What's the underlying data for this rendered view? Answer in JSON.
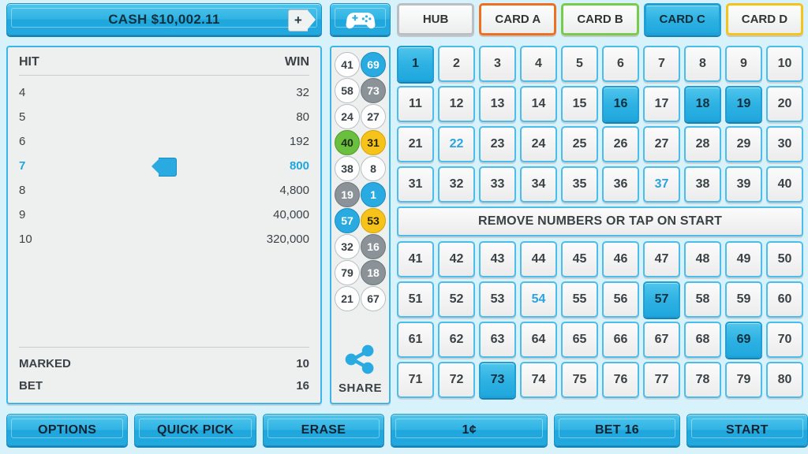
{
  "topbar": {
    "cash_label": "CASH $10,002.11",
    "add_credit_icon": "plus-icon",
    "add_credit_label": "+",
    "game_icon": "gamepad-icon",
    "tabs": [
      {
        "label": "HUB",
        "accent": "#b9bfc2",
        "selected": false
      },
      {
        "label": "CARD A",
        "accent": "#ee6f1f",
        "selected": false
      },
      {
        "label": "CARD B",
        "accent": "#79cc4a",
        "selected": false
      },
      {
        "label": "CARD C",
        "accent": "#1f9fd4",
        "selected": true
      },
      {
        "label": "CARD D",
        "accent": "#f6c31b",
        "selected": false
      }
    ]
  },
  "paytable": {
    "header": {
      "hit": "HIT",
      "win": "WIN"
    },
    "rows": [
      {
        "hit": "4",
        "win": "32",
        "highlighted": false
      },
      {
        "hit": "5",
        "win": "80",
        "highlighted": false
      },
      {
        "hit": "6",
        "win": "192",
        "highlighted": false
      },
      {
        "hit": "7",
        "win": "800",
        "highlighted": true
      },
      {
        "hit": "8",
        "win": "4,800",
        "highlighted": false
      },
      {
        "hit": "9",
        "win": "40,000",
        "highlighted": false
      },
      {
        "hit": "10",
        "win": "320,000",
        "highlighted": false
      }
    ],
    "footer": [
      {
        "label": "MARKED",
        "value": "10"
      },
      {
        "label": "BET",
        "value": "16"
      }
    ]
  },
  "draw_column": {
    "balls": [
      {
        "n": "41",
        "color": "white"
      },
      {
        "n": "69",
        "color": "blue"
      },
      {
        "n": "58",
        "color": "white"
      },
      {
        "n": "73",
        "color": "gray"
      },
      {
        "n": "24",
        "color": "white"
      },
      {
        "n": "27",
        "color": "white"
      },
      {
        "n": "40",
        "color": "green"
      },
      {
        "n": "31",
        "color": "gold"
      },
      {
        "n": "38",
        "color": "white"
      },
      {
        "n": "8",
        "color": "white"
      },
      {
        "n": "19",
        "color": "gray"
      },
      {
        "n": "1",
        "color": "blue"
      },
      {
        "n": "57",
        "color": "blue"
      },
      {
        "n": "53",
        "color": "gold"
      },
      {
        "n": "32",
        "color": "white"
      },
      {
        "n": "16",
        "color": "gray"
      },
      {
        "n": "79",
        "color": "white"
      },
      {
        "n": "18",
        "color": "gray"
      },
      {
        "n": "21",
        "color": "white"
      },
      {
        "n": "67",
        "color": "white"
      }
    ],
    "share_icon": "share-icon",
    "share_label": "SHARE"
  },
  "board": {
    "banner_message": "REMOVE NUMBERS OR TAP ON START",
    "rows_top": [
      [
        {
          "n": "1",
          "state": "selected"
        },
        {
          "n": "2",
          "state": "normal"
        },
        {
          "n": "3",
          "state": "normal"
        },
        {
          "n": "4",
          "state": "normal"
        },
        {
          "n": "5",
          "state": "normal"
        },
        {
          "n": "6",
          "state": "normal"
        },
        {
          "n": "7",
          "state": "normal"
        },
        {
          "n": "8",
          "state": "normal"
        },
        {
          "n": "9",
          "state": "normal"
        },
        {
          "n": "10",
          "state": "normal"
        }
      ],
      [
        {
          "n": "11",
          "state": "normal"
        },
        {
          "n": "12",
          "state": "normal"
        },
        {
          "n": "13",
          "state": "normal"
        },
        {
          "n": "14",
          "state": "normal"
        },
        {
          "n": "15",
          "state": "normal"
        },
        {
          "n": "16",
          "state": "selected"
        },
        {
          "n": "17",
          "state": "normal"
        },
        {
          "n": "18",
          "state": "selected"
        },
        {
          "n": "19",
          "state": "selected"
        },
        {
          "n": "20",
          "state": "normal"
        }
      ],
      [
        {
          "n": "21",
          "state": "normal"
        },
        {
          "n": "22",
          "state": "hint"
        },
        {
          "n": "23",
          "state": "normal"
        },
        {
          "n": "24",
          "state": "normal"
        },
        {
          "n": "25",
          "state": "normal"
        },
        {
          "n": "26",
          "state": "normal"
        },
        {
          "n": "27",
          "state": "normal"
        },
        {
          "n": "28",
          "state": "normal"
        },
        {
          "n": "29",
          "state": "normal"
        },
        {
          "n": "30",
          "state": "normal"
        }
      ],
      [
        {
          "n": "31",
          "state": "normal"
        },
        {
          "n": "32",
          "state": "normal"
        },
        {
          "n": "33",
          "state": "normal"
        },
        {
          "n": "34",
          "state": "normal"
        },
        {
          "n": "35",
          "state": "normal"
        },
        {
          "n": "36",
          "state": "normal"
        },
        {
          "n": "37",
          "state": "hint"
        },
        {
          "n": "38",
          "state": "normal"
        },
        {
          "n": "39",
          "state": "normal"
        },
        {
          "n": "40",
          "state": "normal"
        }
      ]
    ],
    "rows_bottom": [
      [
        {
          "n": "41",
          "state": "normal"
        },
        {
          "n": "42",
          "state": "normal"
        },
        {
          "n": "43",
          "state": "normal"
        },
        {
          "n": "44",
          "state": "normal"
        },
        {
          "n": "45",
          "state": "normal"
        },
        {
          "n": "46",
          "state": "normal"
        },
        {
          "n": "47",
          "state": "normal"
        },
        {
          "n": "48",
          "state": "normal"
        },
        {
          "n": "49",
          "state": "normal"
        },
        {
          "n": "50",
          "state": "normal"
        }
      ],
      [
        {
          "n": "51",
          "state": "normal"
        },
        {
          "n": "52",
          "state": "normal"
        },
        {
          "n": "53",
          "state": "normal"
        },
        {
          "n": "54",
          "state": "hint"
        },
        {
          "n": "55",
          "state": "normal"
        },
        {
          "n": "56",
          "state": "normal"
        },
        {
          "n": "57",
          "state": "selected"
        },
        {
          "n": "58",
          "state": "normal"
        },
        {
          "n": "59",
          "state": "normal"
        },
        {
          "n": "60",
          "state": "normal"
        }
      ],
      [
        {
          "n": "61",
          "state": "normal"
        },
        {
          "n": "62",
          "state": "normal"
        },
        {
          "n": "63",
          "state": "normal"
        },
        {
          "n": "64",
          "state": "normal"
        },
        {
          "n": "65",
          "state": "normal"
        },
        {
          "n": "66",
          "state": "normal"
        },
        {
          "n": "67",
          "state": "normal"
        },
        {
          "n": "68",
          "state": "normal"
        },
        {
          "n": "69",
          "state": "selected"
        },
        {
          "n": "70",
          "state": "normal"
        }
      ],
      [
        {
          "n": "71",
          "state": "normal"
        },
        {
          "n": "72",
          "state": "normal"
        },
        {
          "n": "73",
          "state": "selected"
        },
        {
          "n": "74",
          "state": "normal"
        },
        {
          "n": "75",
          "state": "normal"
        },
        {
          "n": "76",
          "state": "normal"
        },
        {
          "n": "77",
          "state": "normal"
        },
        {
          "n": "78",
          "state": "normal"
        },
        {
          "n": "79",
          "state": "normal"
        },
        {
          "n": "80",
          "state": "normal"
        }
      ]
    ]
  },
  "bottombar": {
    "options": "OPTIONS",
    "quick_pick": "QUICK PICK",
    "erase": "ERASE",
    "coin": "1¢",
    "bet": "BET 16",
    "start": "START"
  },
  "colors": {
    "background": "#d8f2fb",
    "accent_blue": "#29ABE2",
    "panel": "#eef0f0",
    "panel_border": "#3cb6e8"
  }
}
